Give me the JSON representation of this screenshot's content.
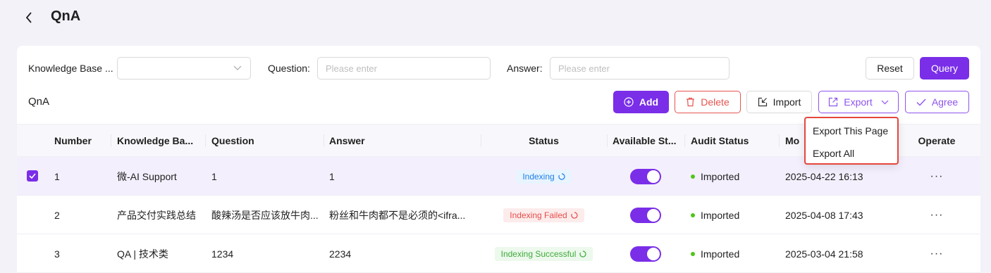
{
  "header": {
    "title": "QnA"
  },
  "filters": {
    "knowledge_base_label": "Knowledge Base ...",
    "question_label": "Question",
    "question_placeholder": "Please enter",
    "answer_label": "Answer",
    "answer_placeholder": "Please enter",
    "reset_label": "Reset",
    "query_label": "Query"
  },
  "toolbar": {
    "section_title": "QnA",
    "add_label": "Add",
    "delete_label": "Delete",
    "import_label": "Import",
    "export_label": "Export",
    "agree_label": "Agree"
  },
  "export_menu": [
    "Export This Page",
    "Export All"
  ],
  "table": {
    "columns": [
      "Number",
      "Knowledge Ba...",
      "Question",
      "Answer",
      "Status",
      "Available St...",
      "Audit Status",
      "Mo",
      "Operate"
    ],
    "rows": [
      {
        "number": "1",
        "kb": "微-AI Support",
        "question": "1",
        "answer": "1",
        "status": "Indexing",
        "available": true,
        "audit": "Imported",
        "modified": "2025-04-22 16:13",
        "operate": "···",
        "selected": true
      },
      {
        "number": "2",
        "kb": "产品交付实践总结",
        "question": "酸辣汤是否应该放牛肉...",
        "answer": "粉丝和牛肉都不是必须的<ifra...",
        "status": "Indexing Failed",
        "available": true,
        "audit": "Imported",
        "modified": "2025-04-08 17:43",
        "operate": "···",
        "selected": false
      },
      {
        "number": "3",
        "kb": "QA | 技术类",
        "question": "1234",
        "answer": "2234",
        "status": "Indexing Successful",
        "available": true,
        "audit": "Imported",
        "modified": "2025-03-04 21:58",
        "operate": "···",
        "selected": false
      }
    ]
  },
  "colors": {
    "primary": "#7a2ee8",
    "danger": "#e6544f",
    "highlight": "#e5473d"
  }
}
